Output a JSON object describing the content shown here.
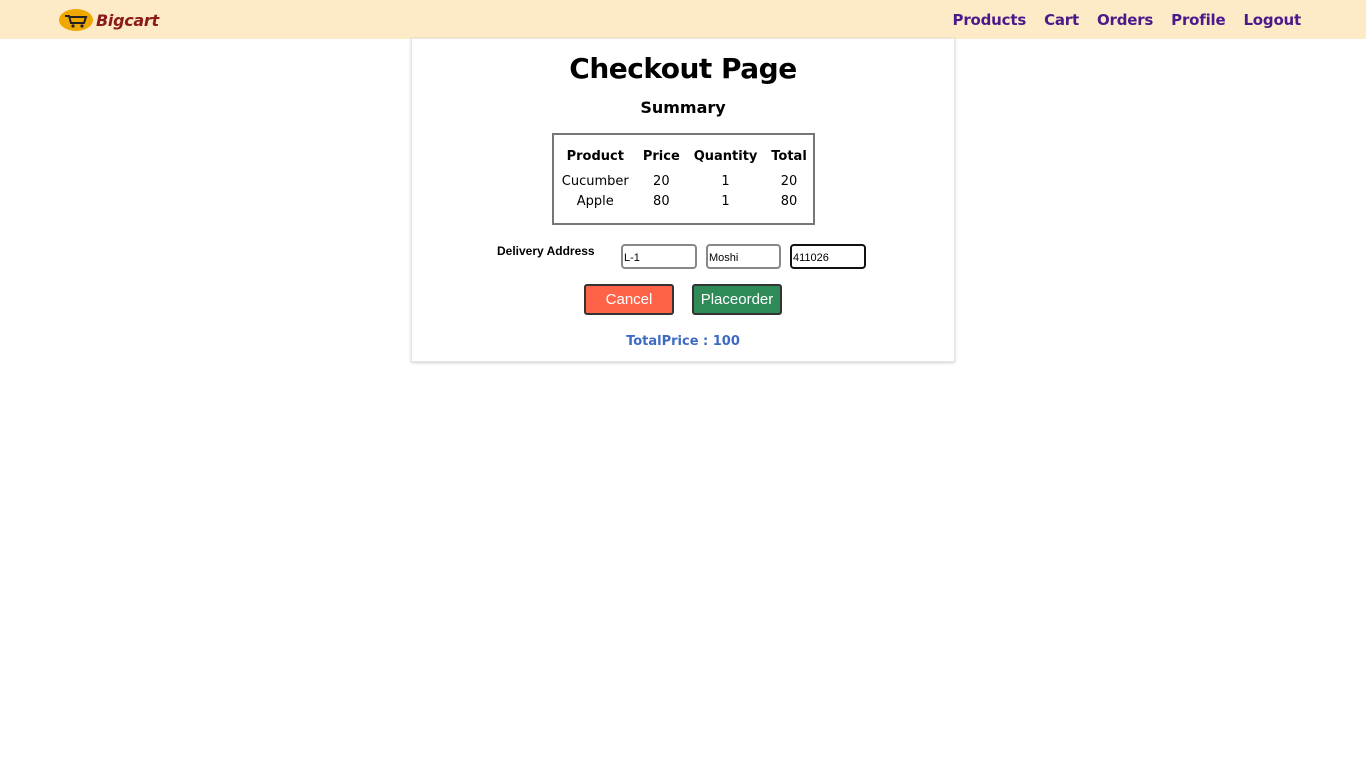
{
  "brand": {
    "name": "Bigcart",
    "logo_icon": "cart-logo-icon"
  },
  "nav": {
    "items": [
      {
        "label": "Products"
      },
      {
        "label": "Cart"
      },
      {
        "label": "Orders"
      },
      {
        "label": "Profile"
      },
      {
        "label": "Logout"
      }
    ]
  },
  "checkout": {
    "title": "Checkout Page",
    "summary_title": "Summary",
    "table": {
      "headers": [
        "Product",
        "Price",
        "Quantity",
        "Total"
      ],
      "rows": [
        [
          "Cucumber",
          "20",
          "1",
          "20"
        ],
        [
          "Apple",
          "80",
          "1",
          "80"
        ]
      ]
    },
    "address": {
      "label": "Delivery Address",
      "line1": "L-1",
      "city": "Moshi",
      "pincode": "411026"
    },
    "buttons": {
      "cancel": "Cancel",
      "place_order": "Placeorder"
    },
    "total_price": "TotalPrice : 100"
  },
  "colors": {
    "navbar_bg": "#fdebc8",
    "nav_link": "#4b1a8a",
    "brand_text": "#8b1a1a",
    "cancel_bg": "#ff6347",
    "place_order_bg": "#2e8b57",
    "total_price": "#3d6ac4"
  }
}
